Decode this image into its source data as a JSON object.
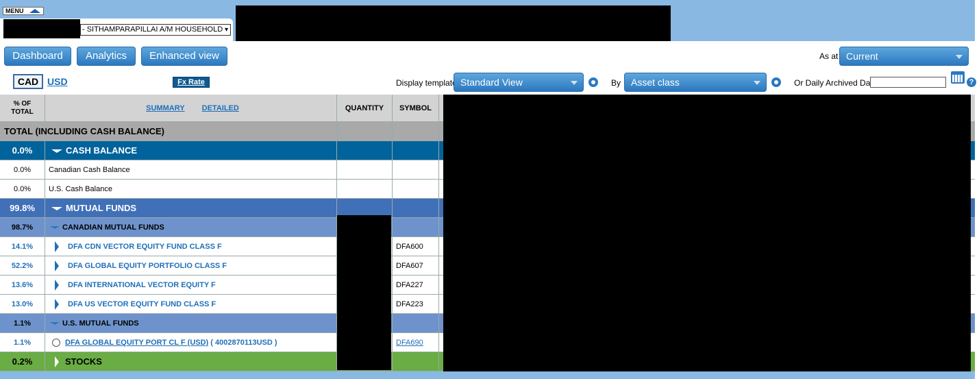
{
  "menu": {
    "label": "MENU"
  },
  "account": {
    "household": "- SITHAMPARAPILLAI A/M HOUSEHOLD"
  },
  "nav": {
    "dashboard": "Dashboard",
    "analytics": "Analytics",
    "enhanced_view": "Enhanced view"
  },
  "as_at": {
    "label": "As at",
    "value": "Current"
  },
  "currency": {
    "cad": "CAD",
    "usd": "USD",
    "fx_rate": "Fx Rate"
  },
  "display_template": {
    "label": "Display template",
    "value": "Standard View"
  },
  "by": {
    "label": "By",
    "value": "Asset class"
  },
  "archived": {
    "label": "Or Daily Archived Data",
    "value": ""
  },
  "colors": {
    "accent": "#2b78bf",
    "cash_balance_row": "#00639c",
    "mutual_funds_row": "#4070b8",
    "sub_category_row": "#6e93cc",
    "stocks_row": "#6aad44",
    "total_row": "#a9a9a9"
  },
  "table": {
    "headers": {
      "pct_line1": "% OF",
      "pct_line2": "TOTAL",
      "summary": "SUMMARY",
      "detailed": "DETAILED",
      "quantity": "QUANTITY",
      "symbol": "SYMBOL"
    },
    "total_label": "TOTAL (INCLUDING CASH BALANCE)",
    "cash_balance": {
      "pct": "0.0%",
      "label": "CASH BALANCE",
      "rows": [
        {
          "pct": "0.0%",
          "name": "Canadian Cash Balance"
        },
        {
          "pct": "0.0%",
          "name": "U.S. Cash Balance"
        }
      ]
    },
    "mutual_funds": {
      "pct": "99.8%",
      "label": "MUTUAL FUNDS",
      "canadian": {
        "pct": "98.7%",
        "label": "CANADIAN MUTUAL FUNDS",
        "funds": [
          {
            "pct": "14.1%",
            "name": "DFA CDN VECTOR EQUITY FUND CLASS F",
            "symbol": "DFA600"
          },
          {
            "pct": "52.2%",
            "name": "DFA GLOBAL EQUITY PORTFOLIO CLASS F",
            "symbol": "DFA607"
          },
          {
            "pct": "13.6%",
            "name": "DFA INTERNATIONAL VECTOR EQUITY F",
            "symbol": "DFA227"
          },
          {
            "pct": "13.0%",
            "name": "DFA US VECTOR EQUITY FUND CLASS F",
            "symbol": "DFA223"
          }
        ]
      },
      "us": {
        "pct": "1.1%",
        "label": "U.S. MUTUAL FUNDS",
        "funds": [
          {
            "pct": "1.1%",
            "name": "DFA GLOBAL EQUITY PORT CL F (USD)",
            "account": "( 4002870113USD )",
            "symbol": "DFA690"
          }
        ]
      }
    },
    "stocks": {
      "pct": "0.2%",
      "label": "STOCKS"
    }
  }
}
